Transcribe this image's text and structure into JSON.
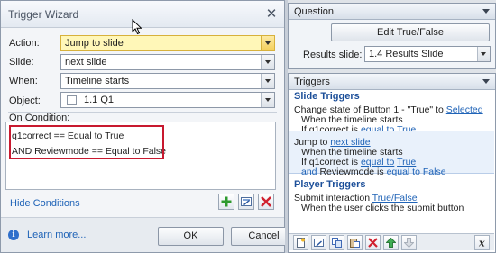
{
  "dialog": {
    "title": "Trigger Wizard",
    "action_label": "Action:",
    "action_value": "Jump to slide",
    "slide_label": "Slide:",
    "slide_value": "next slide",
    "when_label": "When:",
    "when_value": "Timeline starts",
    "object_label": "Object:",
    "object_value": "1.1 Q1",
    "on_condition_label": "On Condition:",
    "conditions": [
      "q1correct == Equal to True",
      "AND Reviewmode == Equal to False"
    ],
    "hide_conditions": "Hide Conditions",
    "learn_more": "Learn more...",
    "ok_label": "OK",
    "cancel_label": "Cancel"
  },
  "question_panel": {
    "title": "Question",
    "edit_button": "Edit True/False",
    "results_label": "Results slide:",
    "results_value": "1.4 Results Slide"
  },
  "triggers_panel": {
    "title": "Triggers",
    "slide_triggers_title": "Slide Triggers",
    "trigger1": {
      "line1_text": "Change state of Button 1 - \"True\" to ",
      "line1_link": "Selected",
      "line2": "When the timeline starts",
      "line3_prefix": "If q1correct is ",
      "line3_link1": "equal to",
      "line3_link2": "True"
    },
    "trigger2": {
      "line1_text": "Jump to ",
      "line1_link": "next slide",
      "line2": "When the timeline starts",
      "line3_prefix": "If q1correct is ",
      "line3_link1": "equal to",
      "line3_link2": "True",
      "line4_and": "and",
      "line4_text": " Reviewmode is ",
      "line4_link1": "equal to",
      "line4_link2": "False"
    },
    "player_triggers_title": "Player Triggers",
    "trigger3": {
      "line1_text": "Submit interaction ",
      "line1_link": "True/False",
      "line2": "When the user clicks the submit button"
    }
  },
  "colors": {
    "highlight_border": "#c8192f",
    "link": "#1f63b7",
    "section_title": "#1c4f99"
  }
}
